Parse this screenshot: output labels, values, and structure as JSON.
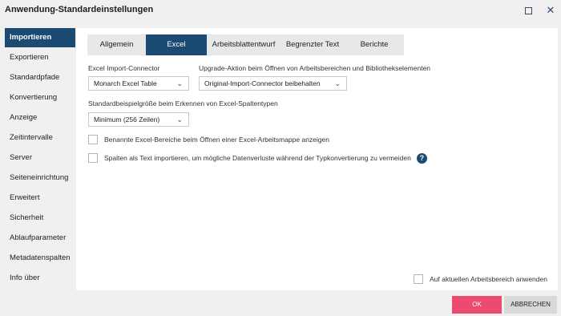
{
  "window": {
    "title": "Anwendung-Standardeinstellungen"
  },
  "sidebar": {
    "items": [
      {
        "label": "Importieren",
        "active": true
      },
      {
        "label": "Exportieren"
      },
      {
        "label": "Standardpfade"
      },
      {
        "label": "Konvertierung"
      },
      {
        "label": "Anzeige"
      },
      {
        "label": "Zeitintervalle"
      },
      {
        "label": "Server"
      },
      {
        "label": "Seiteneinrichtung"
      },
      {
        "label": "Erweitert"
      },
      {
        "label": "Sicherheit"
      },
      {
        "label": "Ablaufparameter"
      },
      {
        "label": "Metadatenspalten"
      },
      {
        "label": "Info über"
      }
    ]
  },
  "tabs": [
    {
      "label": "Allgemein"
    },
    {
      "label": "Excel",
      "active": true
    },
    {
      "label": "Arbeitsblattentwurf"
    },
    {
      "label": "Begrenzter Text"
    },
    {
      "label": "Berichte"
    }
  ],
  "form": {
    "connector": {
      "label": "Excel Import-Connector",
      "value": "Monarch Excel Table"
    },
    "upgrade": {
      "label": "Upgrade-Aktion beim Öffnen von Arbeitsbereichen und Bibliothekselementen",
      "value": "Original-Import-Connector beibehalten"
    },
    "sample": {
      "label": "Standardbeispielgröße beim Erkennen von Excel-Spaltentypen",
      "value": "Minimum (256 Zeilen)"
    },
    "named_ranges": {
      "label": "Benannte Excel-Bereiche beim Öffnen einer Excel-Arbeitsmappe anzeigen",
      "checked": false
    },
    "columns_as_text": {
      "label": "Spalten als Text importieren, um mögliche Datenverluste während der Typkonvertierung zu vermeiden",
      "checked": false
    },
    "apply_current": {
      "label": "Auf aktuellen Arbeitsbereich anwenden",
      "checked": false
    }
  },
  "buttons": {
    "ok": "OK",
    "cancel": "ABBRECHEN"
  },
  "colors": {
    "accent": "#1b4b72",
    "ok": "#ed4a6f"
  }
}
